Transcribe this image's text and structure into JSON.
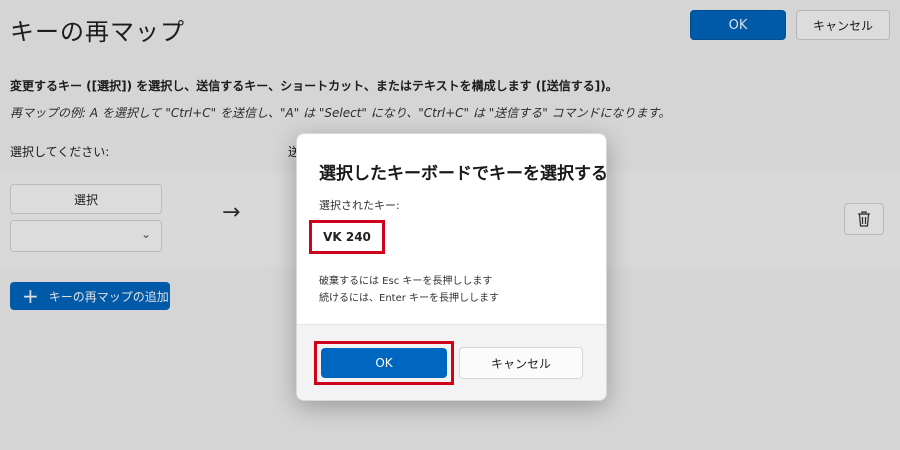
{
  "page": {
    "title": "キーの再マップ",
    "ok_label": "OK",
    "cancel_label": "キャンセル",
    "description": "変更するキー ([選択]) を選択し、送信するキー、ショートカット、またはテキストを構成します ([送信する])。",
    "example": "再マップの例: A を選択して \"Ctrl+C\" を送信し、\"A\" は \"Select\" になり、\"Ctrl+C\" は \"送信する\" コマンドになります。",
    "select_column_label": "選択してください:",
    "send_column_label_partial": "送",
    "select_button_label": "選択",
    "add_remap_label": "キーの再マップの追加",
    "arrow": "→"
  },
  "dialog": {
    "title": "選択したキーボードでキーを選択する",
    "selected_key_label": "選択されたキー:",
    "selected_key_value": "VK 240",
    "hint_discard": "破棄するには Esc キーを長押しします",
    "hint_continue": "続けるには、Enter キーを長押しします",
    "ok_label": "OK",
    "cancel_label": "キャンセル"
  },
  "colors": {
    "accent": "#0067c0",
    "highlight": "#d0021b"
  }
}
